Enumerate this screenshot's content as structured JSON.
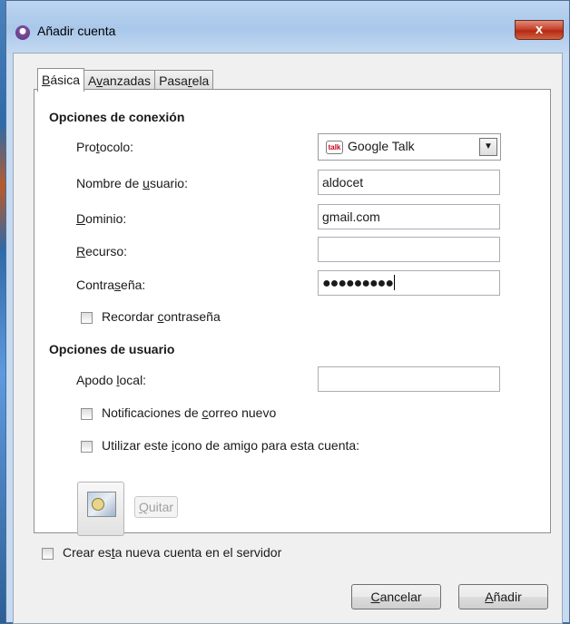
{
  "window": {
    "title": "Añadir cuenta",
    "close_label": "x"
  },
  "tabs": [
    {
      "pre": "",
      "mn": "B",
      "post": "ásica"
    },
    {
      "pre": "A",
      "mn": "v",
      "post": "anzadas"
    },
    {
      "pre": "Pasa",
      "mn": "r",
      "post": "ela"
    }
  ],
  "connection": {
    "heading": "Opciones de conexión",
    "protocol": {
      "pre": "Pro",
      "mn": "t",
      "post": "ocolo:",
      "value": "Google Talk",
      "icon_text": "talk"
    },
    "username": {
      "pre": "Nombre de ",
      "mn": "u",
      "post": "suario:",
      "value": "aldocet"
    },
    "domain": {
      "pre": "",
      "mn": "D",
      "post": "ominio:",
      "value": "gmail.com"
    },
    "resource": {
      "pre": "",
      "mn": "R",
      "post": "ecurso:",
      "value": ""
    },
    "password": {
      "pre": "Contra",
      "mn": "s",
      "post": "eña:",
      "value": "●●●●●●●●●"
    },
    "remember": {
      "pre": "Recordar ",
      "mn": "c",
      "post": "ontraseña",
      "checked": false
    }
  },
  "user": {
    "heading": "Opciones de usuario",
    "alias": {
      "pre": "Apodo ",
      "mn": "l",
      "post": "ocal:",
      "value": ""
    },
    "mail_notify": {
      "pre": "Notificaciones de ",
      "mn": "c",
      "post": "orreo nuevo",
      "checked": false
    },
    "buddy_icon": {
      "pre": "Utilizar este ",
      "mn": "i",
      "post": "cono de amigo para esta cuenta:",
      "checked": false
    },
    "remove": {
      "pre": "",
      "mn": "Q",
      "post": "uitar"
    }
  },
  "footer": {
    "create": {
      "pre": "Crear es",
      "mn": "t",
      "post": "a nueva cuenta en el servidor",
      "checked": false
    },
    "cancel": {
      "pre": "",
      "mn": "C",
      "post": "ancelar"
    },
    "add": {
      "pre": "",
      "mn": "A",
      "post": "ñadir"
    }
  }
}
